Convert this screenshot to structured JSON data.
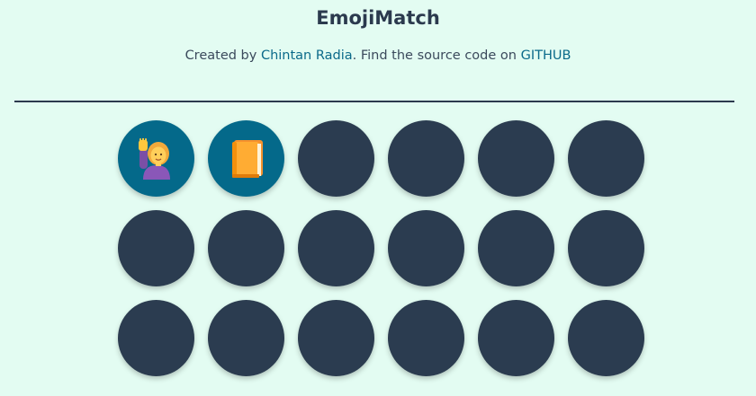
{
  "header": {
    "title": "EmojiMatch",
    "credit_prefix": "Created by ",
    "author_name": "Chintan Radia",
    "credit_middle": ". Find the source code on ",
    "source_link": "GITHUB"
  },
  "board": {
    "rows": 3,
    "columns": 6,
    "hidden_color": "#2b3c50",
    "revealed_color": "#04698a",
    "cards": [
      {
        "state": "revealed",
        "emoji": "person-raising-hand"
      },
      {
        "state": "revealed",
        "emoji": "orange-book"
      },
      {
        "state": "hidden"
      },
      {
        "state": "hidden"
      },
      {
        "state": "hidden"
      },
      {
        "state": "hidden"
      },
      {
        "state": "hidden"
      },
      {
        "state": "hidden"
      },
      {
        "state": "hidden"
      },
      {
        "state": "hidden"
      },
      {
        "state": "hidden"
      },
      {
        "state": "hidden"
      },
      {
        "state": "hidden"
      },
      {
        "state": "hidden"
      },
      {
        "state": "hidden"
      },
      {
        "state": "hidden"
      },
      {
        "state": "hidden"
      },
      {
        "state": "hidden"
      }
    ]
  }
}
